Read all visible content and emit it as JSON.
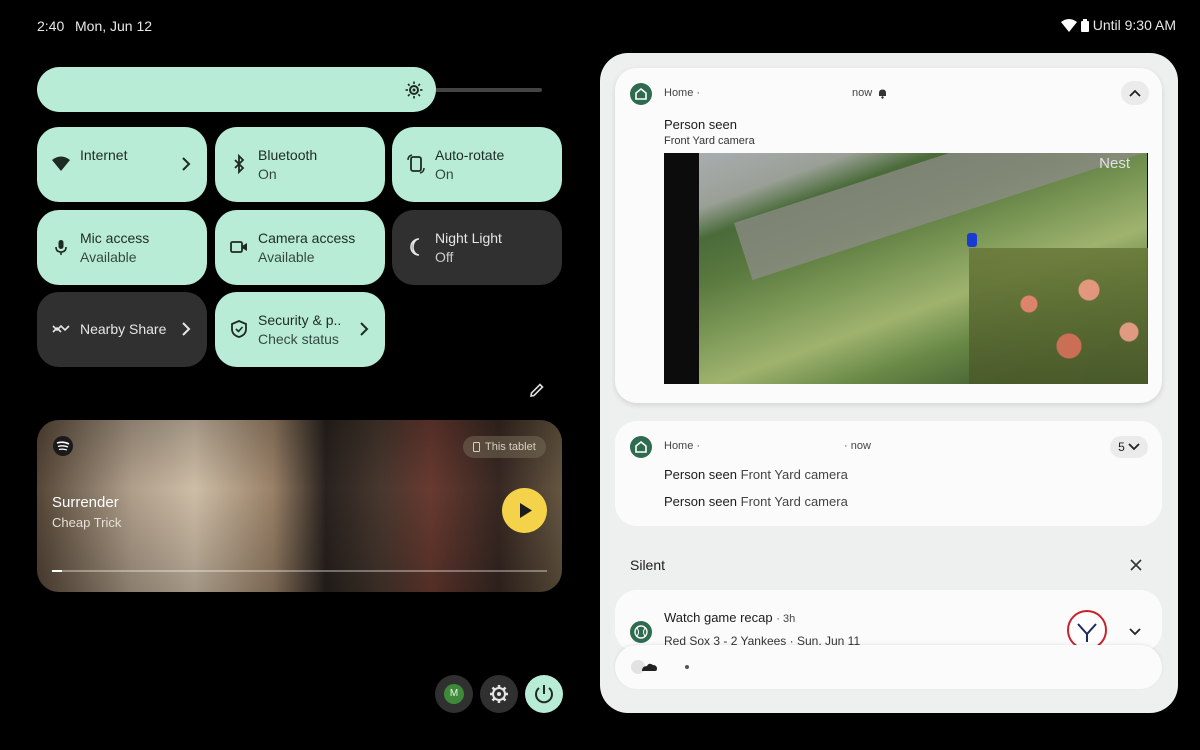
{
  "status_bar": {
    "time": "2:40",
    "date": "Mon, Jun 12",
    "alarm_text": "Until 9:30 AM"
  },
  "brightness": {
    "level": 0.79
  },
  "tiles": [
    {
      "title": "Internet",
      "subtitle": "",
      "active": true
    },
    {
      "title": "Bluetooth",
      "subtitle": "On",
      "active": true
    },
    {
      "title": "Auto-rotate",
      "subtitle": "On",
      "active": true
    },
    {
      "title": "Mic access",
      "subtitle": "Available",
      "active": true
    },
    {
      "title": "Camera access",
      "subtitle": "Available",
      "active": true
    },
    {
      "title": "Night Light",
      "subtitle": "Off",
      "active": false
    },
    {
      "title": "Nearby Share",
      "subtitle": "",
      "active": false
    },
    {
      "title": "Security & p..",
      "subtitle": "Check status",
      "active": true
    }
  ],
  "media": {
    "song": "Surrender",
    "artist": "Cheap Trick",
    "output_chip": "This tablet",
    "progress": 0.02
  },
  "bottom_actions": {
    "avatar_letter": "M"
  },
  "notifications": {
    "home1": {
      "app": "Home",
      "time": "now",
      "title": "Person seen",
      "text": "Front Yard camera",
      "cam_brand": "Nest"
    },
    "home2": {
      "app": "Home",
      "time": "now",
      "count": "5",
      "rows": [
        {
          "title": "Person seen",
          "text": "Front Yard camera"
        },
        {
          "title": "Person seen",
          "text": "Front Yard camera"
        }
      ]
    },
    "silent_header": "Silent",
    "sports": {
      "title": "Watch game recap",
      "time": "3h",
      "text": "Red Sox 3 - 2 Yankees · Sun, Jun 11"
    }
  },
  "colors": {
    "accent": "#b8ecd6",
    "tile_off": "#2f302f",
    "panel": "#eef0ef",
    "play": "#f4d34a",
    "home_icon": "#2e6b4f"
  }
}
